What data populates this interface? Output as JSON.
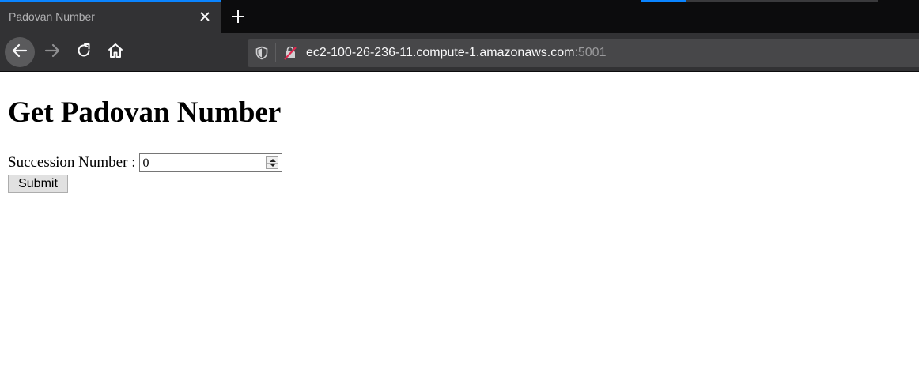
{
  "browser": {
    "tab": {
      "title": "Padovan Number"
    },
    "url": {
      "host": "ec2-100-26-236-11.compute-1.amazonaws.com",
      "port": ":5001"
    },
    "icons": [
      "close-icon",
      "plus-icon",
      "back-arrow-icon",
      "forward-arrow-icon",
      "reload-icon",
      "home-icon",
      "shield-icon",
      "insecure-lock-icon"
    ],
    "colors": {
      "chrome_dark": "#0c0c0d",
      "toolbar": "#323234",
      "urlbar": "#474749",
      "accent": "#0a84ff"
    }
  },
  "page": {
    "heading": "Get Padovan Number",
    "form": {
      "label": "Succession Number :",
      "value": "0",
      "submit_label": "Submit"
    }
  }
}
